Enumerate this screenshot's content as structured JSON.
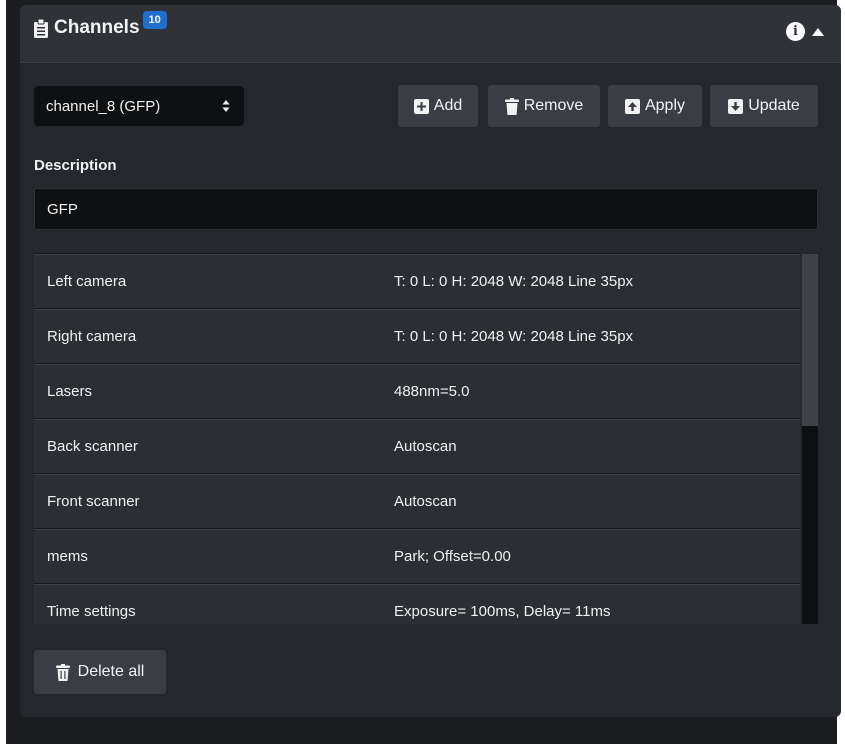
{
  "panel": {
    "title": "Channels",
    "badge_count": "10",
    "icons": [
      "clipboard-icon",
      "info-icon",
      "caret-up-icon"
    ]
  },
  "toolbar": {
    "selected_channel": "channel_8 (GFP)",
    "add_label": "Add",
    "remove_label": "Remove",
    "apply_label": "Apply",
    "update_label": "Update"
  },
  "description": {
    "label": "Description",
    "value": "GFP"
  },
  "table": {
    "rows": [
      {
        "name": "Left camera",
        "value": "T: 0 L: 0 H: 2048 W: 2048 Line 35px"
      },
      {
        "name": "Right camera",
        "value": "T: 0 L: 0 H: 2048 W: 2048 Line 35px"
      },
      {
        "name": "Lasers",
        "value": "488nm=5.0"
      },
      {
        "name": "Back scanner",
        "value": "Autoscan"
      },
      {
        "name": "Front scanner",
        "value": "Autoscan"
      },
      {
        "name": "mems",
        "value": "Park; Offset=0.00"
      },
      {
        "name": "Time settings",
        "value": "Exposure= 100ms, Delay= 11ms"
      }
    ]
  },
  "footer": {
    "delete_all_label": "Delete all"
  },
  "colors": {
    "badge": "#1f6fd1",
    "panel_bg": "#24272c",
    "header_bg": "#2f3237",
    "button_bg": "#3a3e44",
    "input_bg": "#0f1012"
  }
}
